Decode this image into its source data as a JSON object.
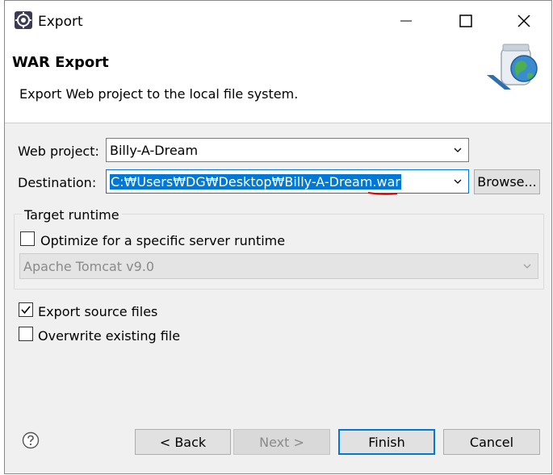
{
  "window": {
    "title": "Export",
    "minimize_icon": "minimize-icon",
    "maximize_icon": "maximize-icon",
    "close_icon": "close-icon"
  },
  "banner": {
    "title": "WAR Export",
    "description": "Export Web project to the local file system."
  },
  "form": {
    "web_project_label": "Web project:",
    "web_project_value": "Billy-A-Dream",
    "destination_label": "Destination:",
    "destination_value": "C:₩Users₩DG₩Desktop₩Billy-A-Dream.war",
    "browse_label": "Browse..."
  },
  "target_runtime": {
    "group_title": "Target runtime",
    "optimize_label": "Optimize for a specific server runtime",
    "optimize_checked": false,
    "runtime_value": "Apache Tomcat v9.0"
  },
  "options": {
    "export_source_label": "Export source files",
    "export_source_checked": true,
    "overwrite_label": "Overwrite existing file",
    "overwrite_checked": false
  },
  "buttons": {
    "back": "< Back",
    "next": "Next >",
    "finish": "Finish",
    "cancel": "Cancel"
  },
  "colors": {
    "selection": "#0078d7",
    "default_button_border": "#0078d7",
    "annotation_underline": "#e00000"
  }
}
